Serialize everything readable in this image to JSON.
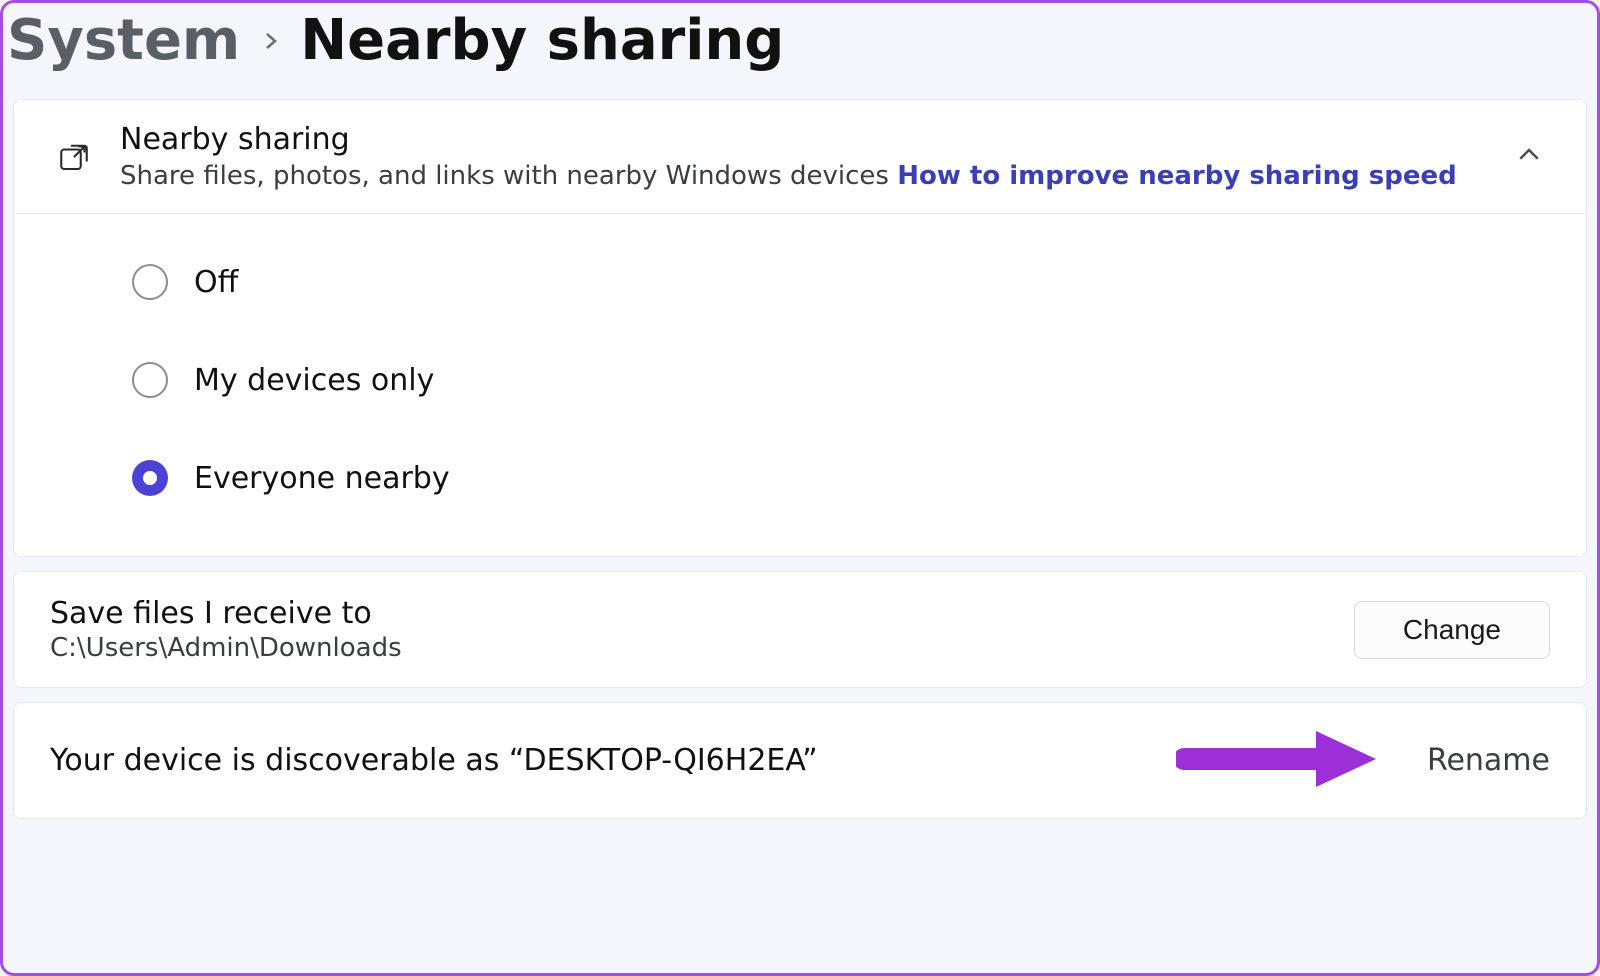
{
  "breadcrumb": {
    "root": "System",
    "current": "Nearby sharing"
  },
  "expander": {
    "title": "Nearby sharing",
    "subtitle_text": "Share files, photos, and links with nearby Windows devices ",
    "subtitle_link": "How to improve nearby sharing speed"
  },
  "radios": {
    "items": [
      {
        "label": "Off",
        "selected": false
      },
      {
        "label": "My devices only",
        "selected": false
      },
      {
        "label": "Everyone nearby",
        "selected": true
      }
    ]
  },
  "save": {
    "title": "Save files I receive to",
    "path": "C:\\Users\\Admin\\Downloads",
    "button": "Change"
  },
  "discover": {
    "text": "Your device is discoverable as “DESKTOP-QI6H2EA”",
    "rename": "Rename"
  }
}
